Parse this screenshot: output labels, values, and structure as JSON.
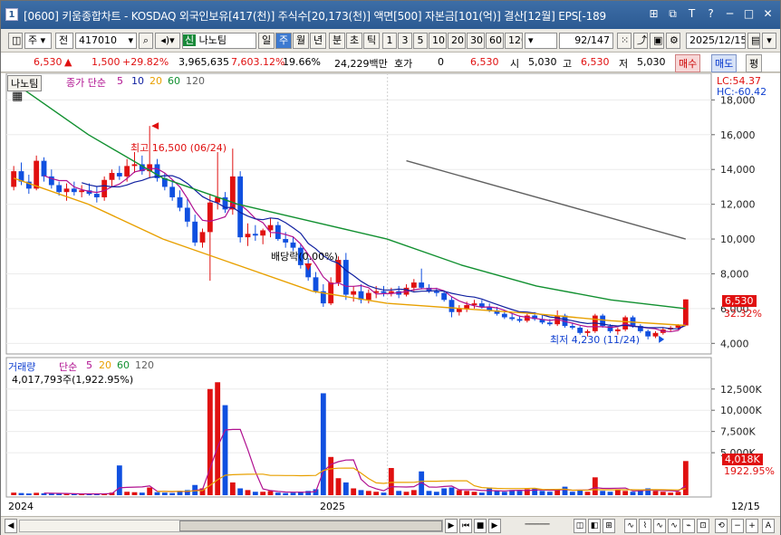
{
  "window": {
    "num": "1",
    "title": "[0600] 키움종합차트 - KOSDAQ 외국인보유[417(천)] 주식수[20,173(천)] 액면[500] 자본금[101(억)] 결산[12월] EPS[-189",
    "buttons": [
      "⊞",
      "⧉",
      "T",
      "?",
      "─",
      "□",
      "✕"
    ]
  },
  "toolbar": {
    "period_week": "주",
    "market": "전",
    "code": "417010",
    "name_badge": "신",
    "name": "나노팀",
    "periods": [
      "일",
      "주",
      "월",
      "년",
      "분",
      "초",
      "틱"
    ],
    "active_period": "주",
    "intervals": [
      "1",
      "3",
      "5",
      "10",
      "20",
      "30",
      "60",
      "120"
    ],
    "count": "92",
    "count_total": "/147",
    "date": "2025/12/15"
  },
  "quote": {
    "price": "6,530",
    "change": "1,500",
    "change_pct": "+29.82%",
    "volume": "3,965,635",
    "vol_pct": "7,603.12%",
    "turnover": "19.66%",
    "amount": "24,229백만",
    "hoga_label": "호가",
    "hoga": "0",
    "hoga_price": "6,530",
    "open_label": "시",
    "open": "5,030",
    "high_label": "고",
    "high": "6,530",
    "low_label": "저",
    "low": "5,030",
    "buy": "매수",
    "sell": "매도",
    "eval": "평"
  },
  "price_pane": {
    "stock_label": "나노팀",
    "ma_label": "종가 단순",
    "ma_periods": [
      "5",
      "10",
      "20",
      "60",
      "120"
    ],
    "ma_colors": [
      "#b01090",
      "#1020a0",
      "#e8a000",
      "#119030",
      "#606060"
    ],
    "lc": "LC:54.37",
    "hc": "HC:-60.42",
    "axis": [
      "18,000",
      "16,000",
      "14,000",
      "12,000",
      "10,000",
      "8,000",
      "6,000",
      "4,000"
    ],
    "high_note": "최고 16,500 (06/24)",
    "low_note": "최저 4,230 (11/24)",
    "div_note": "배당락(0.00%)",
    "last_price": "6,530",
    "last_pct": "32.32%"
  },
  "volume_pane": {
    "label": "거래량",
    "ma_label": "단순",
    "ma_periods": [
      "5",
      "20",
      "60",
      "120"
    ],
    "value_line": "4,017,793주(1,922.95%)",
    "axis": [
      "12,500K",
      "10,000K",
      "7,500K",
      "5,000K"
    ],
    "last_vol": "4,018K",
    "last_pct": "1922.95%"
  },
  "x_axis": {
    "labels": [
      "2024",
      "2025"
    ],
    "right_date": "12/15"
  },
  "colors": {
    "up": "#e01010",
    "down": "#1050e0",
    "title_bg": "#2c5a92"
  },
  "chart_data": {
    "type": "candlestick",
    "title": "나노팀",
    "ylim": [
      4000,
      18000
    ],
    "candles": [
      [
        13000,
        14200,
        12800,
        13900
      ],
      [
        13900,
        14400,
        13100,
        13300
      ],
      [
        13300,
        13700,
        12600,
        12900
      ],
      [
        12900,
        14800,
        12800,
        14500
      ],
      [
        14500,
        14700,
        13300,
        13600
      ],
      [
        13600,
        14000,
        12900,
        13100
      ],
      [
        13100,
        13300,
        12500,
        12700
      ],
      [
        12700,
        13200,
        12200,
        12900
      ],
      [
        12900,
        13300,
        12500,
        12700
      ],
      [
        12700,
        13100,
        12400,
        12800
      ],
      [
        12800,
        13200,
        12500,
        12600
      ],
      [
        12600,
        13000,
        12100,
        12400
      ],
      [
        12400,
        13600,
        12200,
        13400
      ],
      [
        13400,
        14000,
        13000,
        13800
      ],
      [
        13800,
        14200,
        13400,
        13600
      ],
      [
        13600,
        14600,
        13300,
        14200
      ],
      [
        14200,
        15000,
        13800,
        14300
      ],
      [
        14300,
        14800,
        13700,
        13900
      ],
      [
        13900,
        16500,
        13500,
        14300
      ],
      [
        14300,
        14600,
        13300,
        13500
      ],
      [
        13500,
        13800,
        12800,
        13000
      ],
      [
        13000,
        13400,
        12200,
        12400
      ],
      [
        12400,
        12800,
        11600,
        11800
      ],
      [
        11800,
        12300,
        10700,
        11000
      ],
      [
        11000,
        11400,
        9600,
        9800
      ],
      [
        9800,
        10600,
        9500,
        10400
      ],
      [
        10400,
        12600,
        7600,
        12100
      ],
      [
        12100,
        15000,
        11700,
        12400
      ],
      [
        12400,
        12700,
        11500,
        11700
      ],
      [
        11700,
        15200,
        11400,
        13600
      ],
      [
        13600,
        13900,
        9800,
        10100
      ],
      [
        10100,
        10900,
        9600,
        10300
      ],
      [
        10300,
        10800,
        9900,
        10200
      ],
      [
        10200,
        10600,
        9700,
        10500
      ],
      [
        10500,
        11200,
        10100,
        10800
      ],
      [
        10800,
        11000,
        9900,
        10000
      ],
      [
        10000,
        10400,
        9500,
        9800
      ],
      [
        9800,
        10100,
        9300,
        9500
      ],
      [
        9500,
        9700,
        8300,
        8500
      ],
      [
        8500,
        8900,
        7600,
        7800
      ],
      [
        7800,
        8100,
        6900,
        7000
      ],
      [
        7000,
        7400,
        6100,
        6300
      ],
      [
        6300,
        7800,
        6200,
        7500
      ],
      [
        7500,
        9000,
        7300,
        8800
      ],
      [
        8800,
        9200,
        6500,
        6800
      ],
      [
        6800,
        7300,
        6400,
        7000
      ],
      [
        7000,
        7400,
        6300,
        6500
      ],
      [
        6500,
        7100,
        6300,
        6900
      ],
      [
        6900,
        7300,
        6600,
        7000
      ],
      [
        7000,
        7300,
        6700,
        6900
      ],
      [
        6900,
        7200,
        6700,
        7000
      ],
      [
        7000,
        7300,
        6600,
        6800
      ],
      [
        6800,
        7400,
        6700,
        7200
      ],
      [
        7200,
        7700,
        7000,
        7500
      ],
      [
        7500,
        8300,
        7100,
        7200
      ],
      [
        7200,
        7400,
        6900,
        7000
      ],
      [
        7000,
        7200,
        6700,
        6900
      ],
      [
        6900,
        7000,
        6400,
        6500
      ],
      [
        6500,
        6700,
        5500,
        5800
      ],
      [
        5800,
        6200,
        5600,
        6000
      ],
      [
        6000,
        6400,
        5800,
        6200
      ],
      [
        6200,
        6500,
        6000,
        6300
      ],
      [
        6300,
        6500,
        6000,
        6100
      ],
      [
        6100,
        6300,
        5800,
        5900
      ],
      [
        5900,
        6100,
        5600,
        5700
      ],
      [
        5700,
        5900,
        5400,
        5500
      ],
      [
        5500,
        5700,
        5300,
        5400
      ],
      [
        5400,
        5600,
        5200,
        5300
      ],
      [
        5300,
        5700,
        5200,
        5600
      ],
      [
        5600,
        5800,
        5300,
        5400
      ],
      [
        5400,
        5600,
        5100,
        5200
      ],
      [
        5200,
        5400,
        5000,
        5100
      ],
      [
        5100,
        5900,
        5000,
        5600
      ],
      [
        5600,
        5700,
        4900,
        5000
      ],
      [
        5000,
        5200,
        4800,
        4900
      ],
      [
        4900,
        5000,
        4500,
        4600
      ],
      [
        4600,
        4800,
        4400,
        4700
      ],
      [
        4700,
        5700,
        4600,
        5600
      ],
      [
        5600,
        5700,
        4900,
        5000
      ],
      [
        5000,
        5100,
        4600,
        4700
      ],
      [
        4700,
        4900,
        4500,
        4800
      ],
      [
        4800,
        5600,
        4700,
        5500
      ],
      [
        5500,
        5600,
        4900,
        5000
      ],
      [
        5000,
        5100,
        4600,
        4700
      ],
      [
        4700,
        4800,
        4230,
        4400
      ],
      [
        4400,
        4700,
        4300,
        4600
      ],
      [
        4600,
        4900,
        4500,
        4800
      ],
      [
        4800,
        5000,
        4700,
        4900
      ],
      [
        4900,
        5100,
        4800,
        5030
      ],
      [
        5030,
        6530,
        5030,
        6530
      ]
    ],
    "volumes": [
      300,
      250,
      200,
      280,
      220,
      180,
      160,
      150,
      140,
      130,
      150,
      180,
      200,
      300,
      3500,
      400,
      350,
      300,
      900,
      350,
      300,
      250,
      500,
      600,
      1200,
      800,
      12500,
      13300,
      10600,
      1500,
      800,
      600,
      400,
      400,
      500,
      300,
      250,
      300,
      400,
      500,
      700,
      12000,
      4500,
      2000,
      1500,
      800,
      600,
      500,
      400,
      300,
      3200,
      500,
      400,
      600,
      2800,
      500,
      400,
      800,
      900,
      600,
      500,
      400,
      300,
      900,
      500,
      400,
      600,
      500,
      700,
      800,
      500,
      400,
      600,
      1000,
      400,
      600,
      400,
      2100,
      500,
      400,
      700,
      500,
      400,
      600,
      800,
      500,
      400,
      300,
      400,
      4018
    ],
    "ma20_trend": [
      13500,
      12000,
      10000,
      8500,
      7000,
      6300,
      6000,
      5700,
      5300,
      5030
    ],
    "ma60_trend": [
      19000,
      16000,
      13500,
      12000,
      11000,
      10000,
      8500,
      7300,
      6500,
      6000
    ],
    "ma120_trend": [
      14500,
      13000,
      11500,
      10000
    ]
  }
}
